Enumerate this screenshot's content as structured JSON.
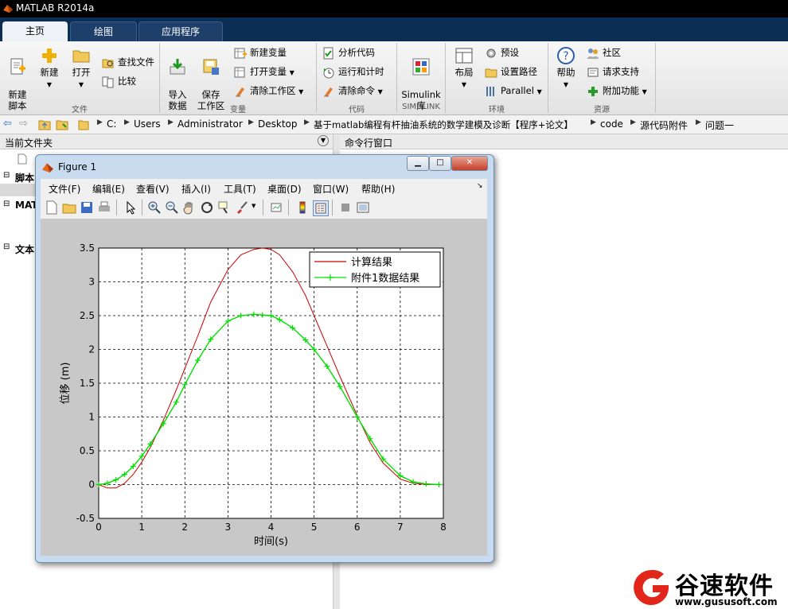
{
  "app": {
    "title": "MATLAB R2014a"
  },
  "tabs": [
    {
      "label": "主页",
      "active": true
    },
    {
      "label": "绘图",
      "active": false
    },
    {
      "label": "应用程序",
      "active": false
    }
  ],
  "ribbon": {
    "new_script": "新建\n脚本",
    "new": "新建",
    "open": "打开",
    "find_files": "查找文件",
    "compare": "比较",
    "group_file": "文件",
    "import_data": "导入\n数据",
    "save_workspace": "保存\n工作区",
    "new_variable": "新建变量",
    "open_variable": "打开变量",
    "clear_workspace": "清除工作区",
    "group_variable": "变量",
    "analyze_code": "分析代码",
    "run_and_time": "运行和计时",
    "clear_commands": "清除命令",
    "group_code": "代码",
    "simulink": "Simulink\n库",
    "group_simulink": "SIMULINK",
    "layout": "布局",
    "preferences": "预设",
    "set_path": "设置路径",
    "parallel": "Parallel",
    "group_env": "环境",
    "help": "帮助",
    "community": "社区",
    "request_support": "请求支持",
    "addons": "附加功能",
    "group_resources": "资源"
  },
  "address": {
    "crumbs": [
      "C:",
      "Users",
      "Administrator",
      "Desktop",
      "基于matlab编程有杆抽油系统的数学建模及诊断【程序+论文】",
      "code",
      "源代码附件",
      "问题一"
    ]
  },
  "left_panel": {
    "header": "当前文件夹",
    "sections": [
      "脚本",
      "MAT",
      "文本"
    ]
  },
  "right_panel": {
    "header": "命令行窗口"
  },
  "figure": {
    "title": "Figure 1",
    "menu": [
      "文件(F)",
      "编辑(E)",
      "查看(V)",
      "插入(I)",
      "工具(T)",
      "桌面(D)",
      "窗口(W)",
      "帮助(H)"
    ]
  },
  "chart_data": {
    "type": "line",
    "xlabel": "时间(s)",
    "ylabel": "位移 (m)",
    "xlim": [
      0,
      8
    ],
    "ylim": [
      -0.5,
      3.5
    ],
    "xticks": [
      0,
      1,
      2,
      3,
      4,
      5,
      6,
      7,
      8
    ],
    "yticks": [
      -0.5,
      0,
      0.5,
      1,
      1.5,
      2,
      2.5,
      3,
      3.5
    ],
    "grid": true,
    "legend_position": "top-right",
    "series": [
      {
        "name": "计算结果",
        "color": "#cc0000",
        "marker": "none",
        "x": [
          0,
          0.2,
          0.4,
          0.6,
          0.8,
          1.0,
          1.2,
          1.5,
          1.8,
          2.0,
          2.3,
          2.6,
          3.0,
          3.3,
          3.6,
          3.8,
          4.0,
          4.2,
          4.5,
          4.8,
          5.0,
          5.3,
          5.6,
          6.0,
          6.3,
          6.6,
          7.0,
          7.3,
          7.6,
          7.9
        ],
        "y": [
          0.0,
          -0.05,
          -0.05,
          0.02,
          0.15,
          0.33,
          0.55,
          0.95,
          1.4,
          1.72,
          2.2,
          2.7,
          3.18,
          3.4,
          3.48,
          3.5,
          3.48,
          3.4,
          3.15,
          2.8,
          2.5,
          2.05,
          1.6,
          1.02,
          0.62,
          0.32,
          0.08,
          0.02,
          0.0,
          0.0
        ]
      },
      {
        "name": "附件1数据结果",
        "color": "#00e000",
        "marker": "+",
        "x": [
          0,
          0.2,
          0.4,
          0.6,
          0.8,
          1.0,
          1.2,
          1.5,
          1.8,
          2.0,
          2.3,
          2.6,
          3.0,
          3.3,
          3.6,
          3.8,
          4.0,
          4.2,
          4.5,
          4.8,
          5.0,
          5.3,
          5.6,
          6.0,
          6.3,
          6.6,
          7.0,
          7.3,
          7.6,
          7.9
        ],
        "y": [
          0.0,
          0.02,
          0.07,
          0.15,
          0.27,
          0.42,
          0.6,
          0.9,
          1.22,
          1.48,
          1.84,
          2.15,
          2.42,
          2.5,
          2.52,
          2.51,
          2.5,
          2.44,
          2.32,
          2.14,
          2.0,
          1.75,
          1.45,
          1.0,
          0.68,
          0.38,
          0.13,
          0.04,
          0.01,
          0.0
        ]
      }
    ]
  },
  "watermark": {
    "brand": "谷速软件",
    "url": "www.gususoft.com"
  }
}
